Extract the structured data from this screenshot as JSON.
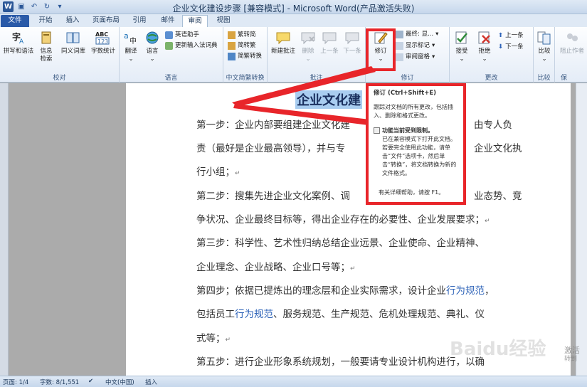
{
  "window": {
    "title": "企业文化建设步骤 [兼容模式] - Microsoft Word(产品激活失败)",
    "app_icon": "W"
  },
  "tabs": [
    {
      "label": "文件",
      "kind": "file"
    },
    {
      "label": "开始"
    },
    {
      "label": "插入"
    },
    {
      "label": "页面布局"
    },
    {
      "label": "引用"
    },
    {
      "label": "邮件"
    },
    {
      "label": "审阅",
      "active": true
    },
    {
      "label": "视图"
    }
  ],
  "ribbon": {
    "proofing": {
      "group_label": "校对",
      "spelling": "拼写和语法",
      "research": "信息\n检索",
      "thesaurus": "同义词库",
      "word_count": "字数统计"
    },
    "language": {
      "group_label": "语言",
      "translate": "翻译",
      "language": "语言",
      "english_assistant": "英语助手",
      "update_ime": "更新输入法词典"
    },
    "chinese_conversion": {
      "group_label": "中文简繁转换",
      "to_simplified": "繁转简",
      "to_traditional": "简转繁",
      "convert": "简繁转换"
    },
    "comments": {
      "group_label": "批注",
      "new_comment": "新建批注",
      "delete": "删除",
      "previous": "上一条",
      "next": "下一条"
    },
    "tracking": {
      "group_label": "修订",
      "track_changes": "修订",
      "display_final": "最终: 显...",
      "show_markup": "显示标记",
      "reviewing_pane": "审阅窗格"
    },
    "changes": {
      "group_label": "更改",
      "accept": "接受",
      "reject": "拒绝",
      "previous": "上一条",
      "next": "下一条"
    },
    "compare": {
      "group_label": "比较",
      "compare": "比较"
    },
    "protect": {
      "group_label": "保",
      "block_authors": "阻止作者"
    }
  },
  "tooltip": {
    "title": "修订 (Ctrl+Shift+E)",
    "description": "跟踪对文档的所有更改，包括插入、删除和格式更改。",
    "lock_title": "功能当前受到限制。",
    "lock_body": "已在兼容模式下打开此文档。若要完全使用此功能，请单击“文件”选项卡，然后单击“转换”，将文档转换为新的文件格式。",
    "help": "有关详细帮助，请按 F1。"
  },
  "document": {
    "heading": "企业文化建",
    "lines": [
      {
        "parts": [
          {
            "t": "第一步：企业内部要组建企业文化建"
          },
          {
            "t": "由专人负",
            "gap": true
          }
        ]
      },
      {
        "parts": [
          {
            "t": "责（最好是企业最高领导），并与专"
          },
          {
            "t": "企业文化执",
            "gap": true
          }
        ]
      },
      {
        "parts": [
          {
            "t": "行小组；"
          }
        ],
        "mark": "↵"
      },
      {
        "parts": [
          {
            "t": "第二步：搜集先进企业文化案例、调"
          },
          {
            "t": "业态势、竞",
            "gap": true
          }
        ]
      },
      {
        "parts": [
          {
            "t": "争状况、企业最终目标等，得出企业存在的必要性、企业发展要求；"
          }
        ],
        "mark": "↵"
      },
      {
        "parts": [
          {
            "t": "第三步：科学性、艺术性归纳总结企业远景、企业使命、企业精神、"
          }
        ]
      },
      {
        "parts": [
          {
            "t": "企业理念、企业战略、企业口号等；"
          }
        ],
        "mark": "↵"
      },
      {
        "parts": [
          {
            "t": "第四步；依据已提炼出的理念层和企业实际需求，设计企业"
          },
          {
            "t": "行为规范",
            "blue": true
          },
          {
            "t": "，"
          }
        ]
      },
      {
        "parts": [
          {
            "t": "包括员工"
          },
          {
            "t": "行为规范",
            "blue": true
          },
          {
            "t": "、服务规范、生产规范、危机处理规范、典礼、仪"
          }
        ]
      },
      {
        "parts": [
          {
            "t": "式等；"
          }
        ],
        "mark": "↵"
      },
      {
        "parts": [
          {
            "t": "第五步：进行企业形象系统规划，一般要请专业设计机构进行，以确"
          }
        ]
      }
    ]
  },
  "statusbar": {
    "page": "页面: 1/4",
    "words": "字数: 8/1,551",
    "language": "中文(中国)",
    "insert_mode": "插入"
  },
  "watermark": {
    "text": "Baidu经验",
    "activate_line1": "激活",
    "activate_line2": "转到"
  },
  "colors": {
    "highlight_red": "#e8252a",
    "file_tab": "#2a5aa8",
    "link_blue": "#2e63b8",
    "selection": "#a9cdf0"
  }
}
